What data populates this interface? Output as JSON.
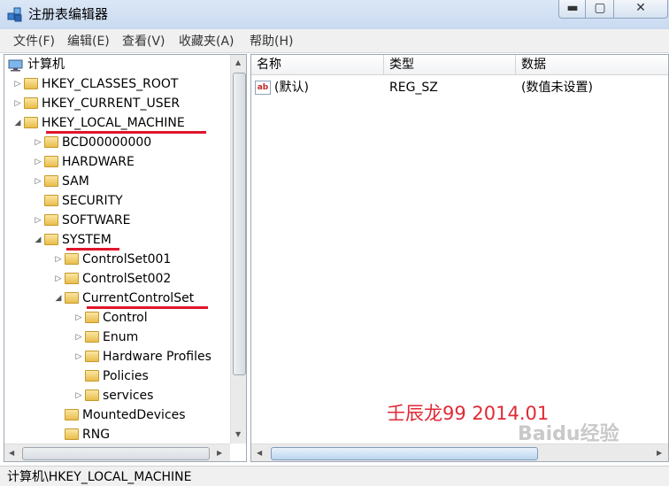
{
  "window": {
    "title": "注册表编辑器",
    "minimize": "▬",
    "maximize": "▢",
    "close": "✕"
  },
  "menu": [
    "文件(F)",
    "编辑(E)",
    "查看(V)",
    "收藏夹(A)",
    "帮助(H)"
  ],
  "tree": {
    "root": "计算机",
    "nodes": [
      {
        "label": "HKEY_CLASSES_ROOT",
        "expander": "▷"
      },
      {
        "label": "HKEY_CURRENT_USER",
        "expander": "▷"
      },
      {
        "label": "HKEY_LOCAL_MACHINE",
        "expander": "◢"
      },
      {
        "label": "BCD00000000",
        "expander": "▷"
      },
      {
        "label": "HARDWARE",
        "expander": "▷"
      },
      {
        "label": "SAM",
        "expander": "▷"
      },
      {
        "label": "SECURITY",
        "expander": ""
      },
      {
        "label": "SOFTWARE",
        "expander": "▷"
      },
      {
        "label": "SYSTEM",
        "expander": "◢"
      },
      {
        "label": "ControlSet001",
        "expander": "▷"
      },
      {
        "label": "ControlSet002",
        "expander": "▷"
      },
      {
        "label": "CurrentControlSet",
        "expander": "◢"
      },
      {
        "label": "Control",
        "expander": "▷"
      },
      {
        "label": "Enum",
        "expander": "▷"
      },
      {
        "label": "Hardware Profiles",
        "expander": "▷"
      },
      {
        "label": "Policies",
        "expander": ""
      },
      {
        "label": "services",
        "expander": "▷"
      },
      {
        "label": "MountedDevices",
        "expander": ""
      },
      {
        "label": "RNG",
        "expander": ""
      }
    ]
  },
  "list": {
    "columns": [
      "名称",
      "类型",
      "数据"
    ],
    "rows": [
      {
        "name": "(默认)",
        "type": "REG_SZ",
        "data": "(数值未设置)"
      }
    ],
    "icon_text": "ab"
  },
  "annotation": "壬辰龙99 2014.01",
  "watermark": "Baidu经验",
  "status": "计算机\\HKEY_LOCAL_MACHINE",
  "colors": {
    "highlight_underline": "#e0162b"
  }
}
